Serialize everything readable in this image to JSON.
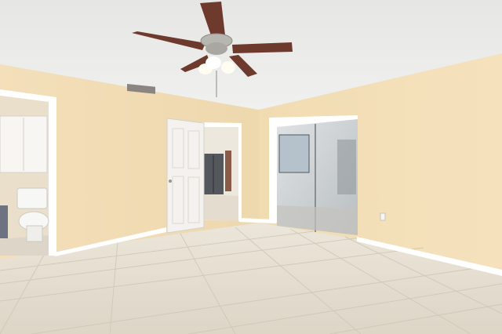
{
  "scene": {
    "colors": {
      "ceiling": "#ebebea",
      "wall_left": "#f1dcb4",
      "wall_right": "#f3dfb8",
      "floor": "#e3dccf",
      "trim": "#ffffff",
      "fan_blade": "#6e3a2e",
      "door": "#f4f2ee",
      "glass": "#cfd3d6",
      "fridge": "#54585c"
    },
    "objects": [
      "ceiling-fan",
      "light-fixture",
      "air-vent",
      "paneled-door",
      "sliding-glass-door",
      "refrigerator",
      "toilet",
      "wall-cabinet",
      "tile-floor",
      "baseboard",
      "electrical-outlet"
    ]
  }
}
